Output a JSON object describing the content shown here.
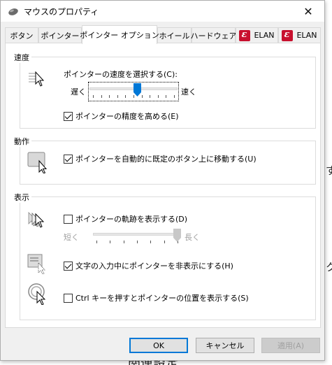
{
  "window": {
    "title": "マウスのプロパティ"
  },
  "tabs": [
    {
      "label": "ボタン"
    },
    {
      "label": "ポインター"
    },
    {
      "label": "ポインター オプション"
    },
    {
      "label": "ホイール"
    },
    {
      "label": "ハードウェア"
    },
    {
      "label": "ELAN"
    },
    {
      "label": "ELAN"
    }
  ],
  "motion": {
    "group_label": "速度",
    "speed_label": "ポインターの速度を選択する(C):",
    "slow_label": "遅く",
    "fast_label": "速く",
    "speed_level": 0.55,
    "precision_label": "ポインターの精度を高める(E)",
    "precision_checked": true
  },
  "snap": {
    "group_label": "動作",
    "snap_label": "ポインターを自動的に既定のボタン上に移動する(U)",
    "snap_checked": true
  },
  "visibility": {
    "group_label": "表示",
    "trails_label": "ポインターの軌跡を表示する(D)",
    "trails_checked": false,
    "short_label": "短く",
    "long_label": "長く",
    "trail_level": 1.0,
    "hide_label": "文字の入力中にポインターを非表示にする(H)",
    "hide_checked": true,
    "ctrl_label": "Ctrl キーを押すとポインターの位置を表示する(S)",
    "ctrl_checked": false
  },
  "buttons": {
    "ok": "OK",
    "cancel": "キャンセル",
    "apply": "適用(A)"
  },
  "background": {
    "glyph_1": "す",
    "glyph_2": "ク",
    "bottom_text": "関連設定"
  }
}
